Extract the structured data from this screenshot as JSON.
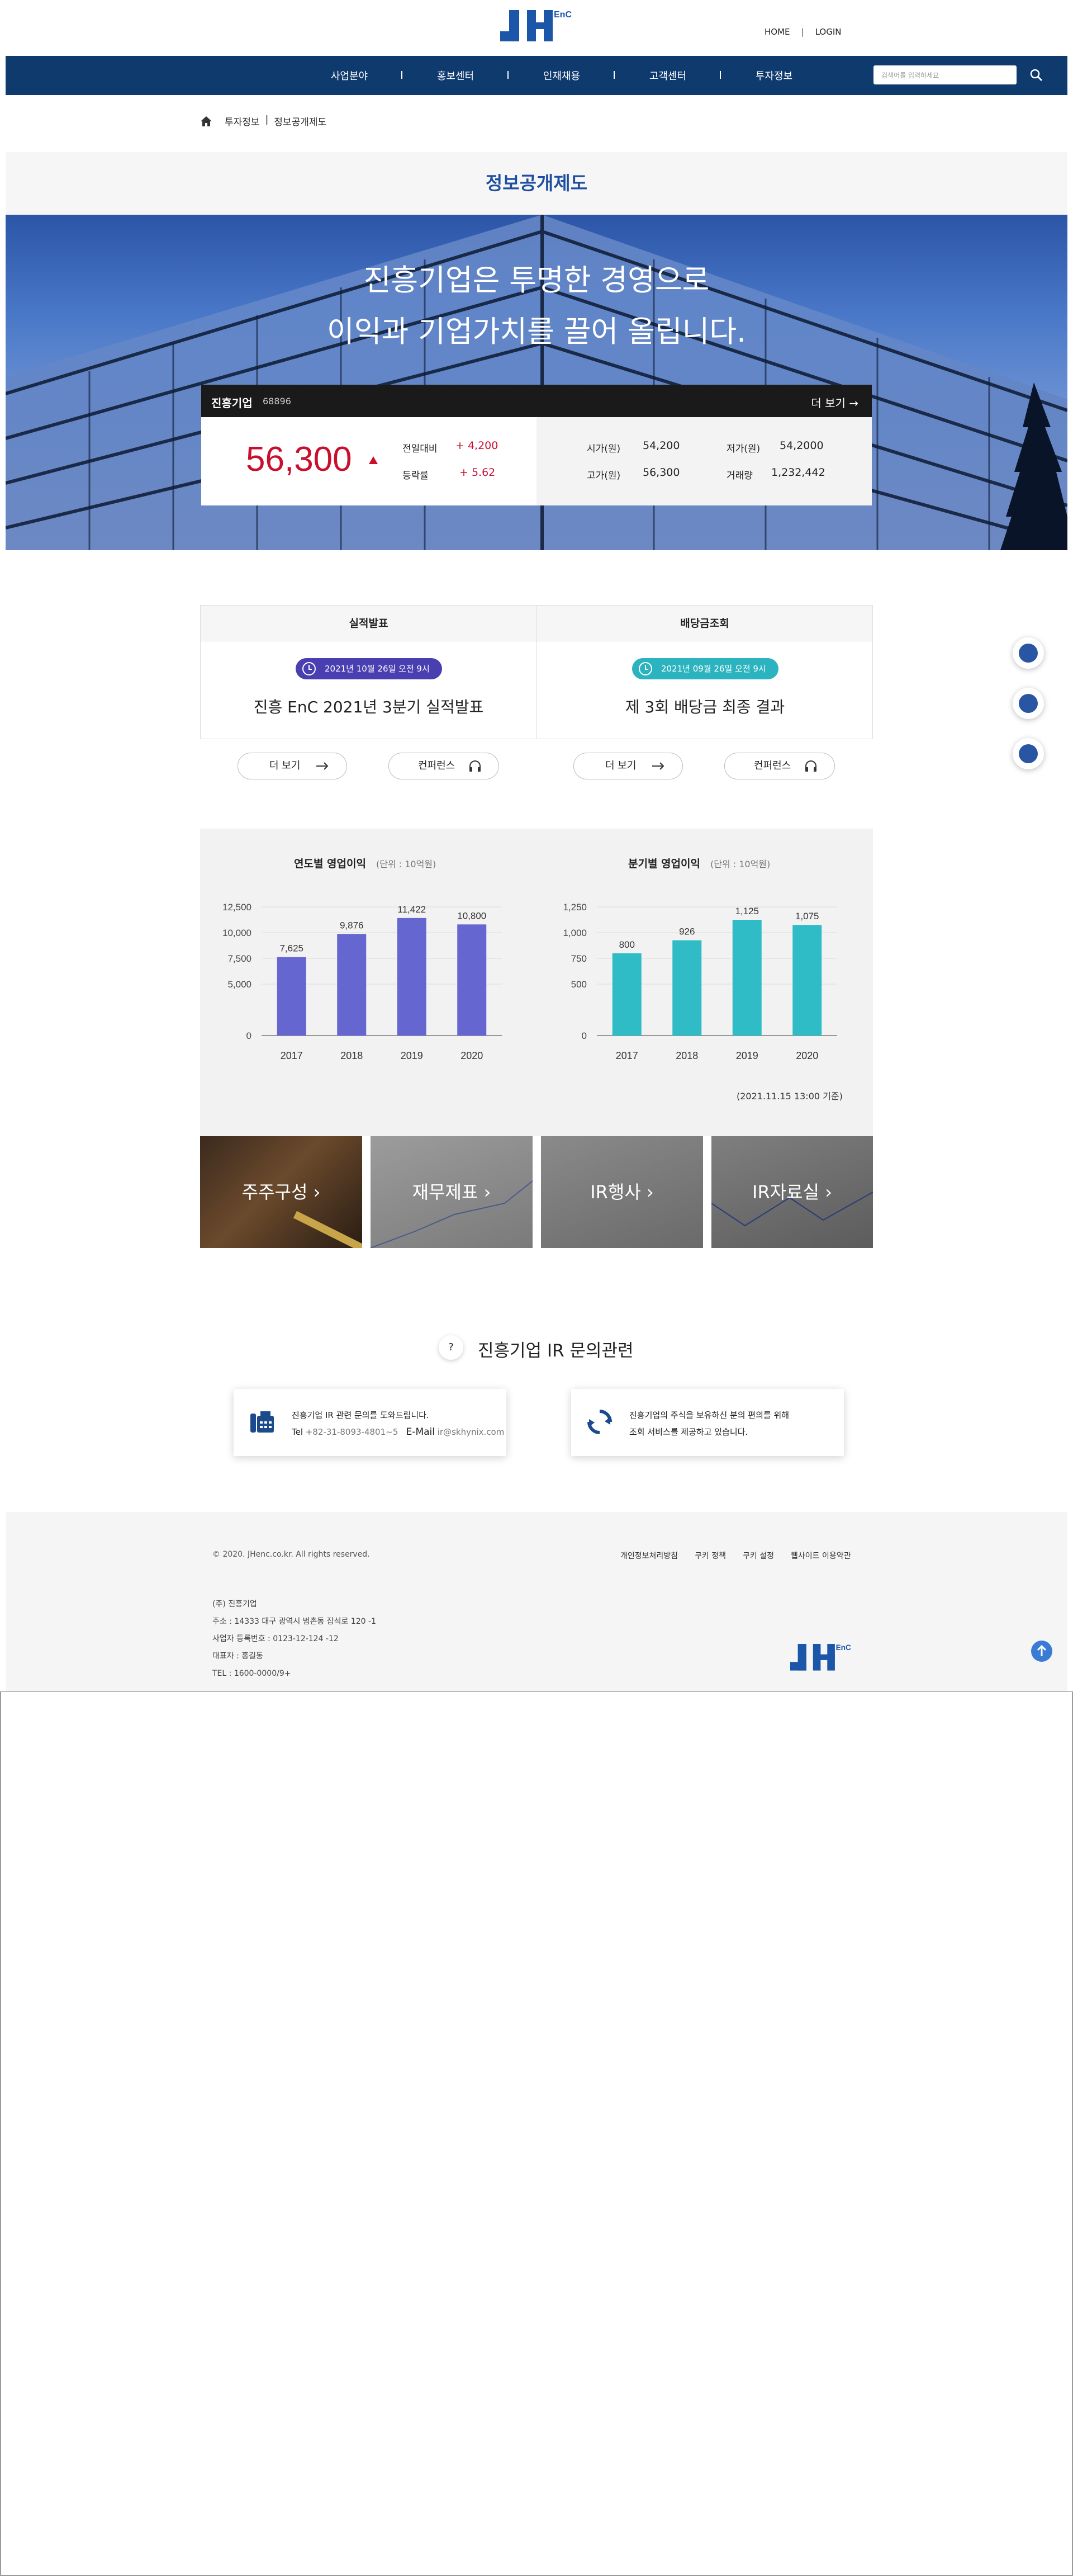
{
  "header": {
    "logo_suffix": "EnC",
    "home_label": "HOME",
    "login_label": "LOGIN",
    "nav": [
      "사업분야",
      "홍보센터",
      "인재채용",
      "고객센터",
      "투자정보"
    ],
    "search_placeholder": "검색어를 입력하세요"
  },
  "breadcrumb": [
    "투자정보",
    "정보공개제도"
  ],
  "page_title": "정보공개제도",
  "hero": {
    "line1": "진흥기업은 투명한 경영으로",
    "line2": "이익과 기업가치를 끌어 올립니다."
  },
  "stock": {
    "name": "진흥기업",
    "code": "68896",
    "more_label": "더 보기",
    "price": "56,300",
    "change_label": "전일대비",
    "change_value": "+ 4,200",
    "rate_label": "등락률",
    "rate_value": "+ 5.62",
    "market_label": "시가(원)",
    "market_value": "54,200",
    "low_label": "저가(원)",
    "low_value": "54,2000",
    "high_label": "고가(원)",
    "high_value": "56,300",
    "volume_label": "거래량",
    "volume_value": "1,232,442"
  },
  "announcements": [
    {
      "header": "실적발표",
      "date": "2021년 10월 26일 오전 9시",
      "title": "진흥 EnC 2021년 3분기 실적발표",
      "color": "#4a3fb0"
    },
    {
      "header": "배당금조회",
      "date": "2021년 09월 26일 오전 9시",
      "title": "제 3회 배당금 최종 결과",
      "color": "#2bb3bf"
    }
  ],
  "buttons": {
    "more": "더 보기",
    "conference": "컨퍼런스"
  },
  "chart_data": [
    {
      "type": "bar",
      "title": "연도별 영업이익",
      "unit": "(단위 : 10억원)",
      "categories": [
        "2017",
        "2018",
        "2019",
        "2020"
      ],
      "values": [
        7625,
        9876,
        11422,
        10800
      ],
      "labels": [
        "7,625",
        "9,876",
        "11,422",
        "10,800"
      ],
      "yticks": [
        "0",
        "5,000",
        "7,500",
        "10,000",
        "12,500"
      ],
      "ytick_values": [
        0,
        5000,
        7500,
        10000,
        12500
      ],
      "ylim": [
        0,
        12500
      ],
      "color": "#6566d0"
    },
    {
      "type": "bar",
      "title": "분기별 영업이익",
      "unit": "(단위 : 10억원)",
      "categories": [
        "2017",
        "2018",
        "2019",
        "2020"
      ],
      "values": [
        800,
        926,
        1125,
        1075
      ],
      "labels": [
        "800",
        "926",
        "1,125",
        "1,075"
      ],
      "yticks": [
        "0",
        "500",
        "750",
        "1,000",
        "1,250"
      ],
      "ytick_values": [
        0,
        500,
        750,
        1000,
        1250
      ],
      "ylim": [
        0,
        1250
      ],
      "color": "#2fbcc6"
    }
  ],
  "as_of": "(2021.11.15 13:00 기준)",
  "tiles": [
    "주주구성",
    "재무제표",
    "IR행사",
    "IR자료실"
  ],
  "contact": {
    "title": "진흥기업 IR 문의관련",
    "card1_line1": "진흥기업 IR 관련 문의를 도와드립니다.",
    "card1_tel_label": "Tel",
    "card1_tel": "+82-31-8093-4801~5",
    "card1_email_label": "E-Mail",
    "card1_email": "ir@skhynix.com",
    "card2_line1": "진흥기업의 주식을 보유하신 분의 편의를 위해",
    "card2_line2": "조회 서비스를 제공하고 있습니다."
  },
  "footer": {
    "copyright": "© 2020. JHenc.co.kr. All rights reserved.",
    "links": [
      "개인정보처리방침",
      "쿠키 정책",
      "쿠키 설정",
      "웹사이트 이용약관"
    ],
    "company": "(주) 진흥기업",
    "address": "주소 : 14333 대구 광역시 범촌동 잡석로 120 -1",
    "biz_no": "사업자 등록번호 : 0123-12-124 -12",
    "ceo": "대표자 : 홍길동",
    "tel": "TEL : 1600-0000/9+"
  }
}
